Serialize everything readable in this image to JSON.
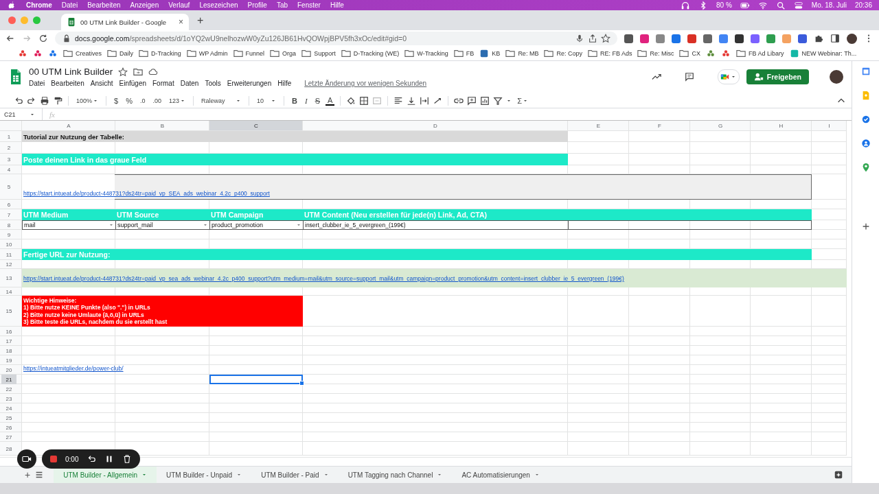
{
  "menubar": {
    "app": "Chrome",
    "menus": [
      "Datei",
      "Bearbeiten",
      "Anzeigen",
      "Verlauf",
      "Lesezeichen",
      "Profile",
      "Tab",
      "Fenster",
      "Hilfe"
    ],
    "battery": "80 %",
    "date": "Mo. 18. Juli",
    "time": "20:36"
  },
  "browser": {
    "tab_title": "00 UTM Link Builder - Google",
    "tab_close": "×",
    "new_tab": "+",
    "url_host": "docs.google.com",
    "url_path": "/spreadsheets/d/1oYQ2wU9nelhozwW0yZu126JB61HvQOWpjBPV5fh3xOc/edit#gid=0",
    "bookmarks": [
      {
        "kind": "icon"
      },
      {
        "kind": "icon"
      },
      {
        "kind": "icon"
      },
      {
        "kind": "folder",
        "label": "Creatives"
      },
      {
        "kind": "folder",
        "label": "Daily"
      },
      {
        "kind": "folder",
        "label": "D-Tracking"
      },
      {
        "kind": "folder",
        "label": "WP Admin"
      },
      {
        "kind": "folder",
        "label": "Funnel"
      },
      {
        "kind": "folder",
        "label": "Orga"
      },
      {
        "kind": "folder",
        "label": "Support"
      },
      {
        "kind": "folder",
        "label": "D-Tracking (WE)"
      },
      {
        "kind": "folder",
        "label": "W-Tracking"
      },
      {
        "kind": "folder",
        "label": "FB"
      },
      {
        "kind": "site",
        "label": "KB"
      },
      {
        "kind": "folder",
        "label": "Re: MB"
      },
      {
        "kind": "folder",
        "label": "Re: Copy"
      },
      {
        "kind": "folder",
        "label": "RE: FB Ads"
      },
      {
        "kind": "folder",
        "label": "Re: Misc"
      },
      {
        "kind": "folder",
        "label": "CX"
      },
      {
        "kind": "icon"
      },
      {
        "kind": "icon"
      },
      {
        "kind": "folder",
        "label": "FB Ad Libary"
      },
      {
        "kind": "site",
        "label": "NEW Webinar: Th..."
      }
    ]
  },
  "sheets": {
    "doc_title": "00 UTM Link Builder",
    "menus": [
      "Datei",
      "Bearbeiten",
      "Ansicht",
      "Einfügen",
      "Format",
      "Daten",
      "Tools",
      "Erweiterungen",
      "Hilfe"
    ],
    "last_edit": "Letzte Änderung vor wenigen Sekunden",
    "share": "Freigeben"
  },
  "toolbar": {
    "zoom": "100%",
    "currency": "$",
    "percent": "%",
    "decrease_decimals": ".0",
    "increase_decimals": ".00",
    "more_formats": "123",
    "font_picker": "Raleway",
    "size_picker": "10",
    "bold": "B",
    "italic": "I",
    "strikethrough": "S",
    "text_color": "A",
    "functions": "Σ"
  },
  "formula_bar": {
    "name_box": "C21",
    "formula_label": "fx"
  },
  "columns": [
    {
      "label": "A",
      "selected": false
    },
    {
      "label": "B",
      "selected": false
    },
    {
      "label": "C",
      "selected": true
    },
    {
      "label": "D",
      "selected": false
    },
    {
      "label": "E",
      "selected": false
    },
    {
      "label": "F",
      "selected": false
    },
    {
      "label": "G",
      "selected": false
    },
    {
      "label": "H",
      "selected": false
    },
    {
      "label": "I",
      "selected": false
    }
  ],
  "rows": [
    {
      "number": "1",
      "selected": false,
      "cells": [
        {
          "kind": "title",
          "text": "Tutorial zur Nutzung der Tabelle:"
        }
      ]
    },
    {
      "number": "2",
      "selected": false
    },
    {
      "number": "3",
      "selected": false,
      "cells": [
        {
          "kind": "banner",
          "text": "Poste deinen Link in das graue Feld"
        }
      ]
    },
    {
      "number": "4",
      "selected": false
    },
    {
      "number": "5",
      "selected": false,
      "cells": [
        {
          "kind": "input"
        },
        {
          "kind": "link",
          "text": "https://start.intueat.de/product-448731?ds24tr=paid_vp_SEA_ads_webinar_4.2c_p400_support"
        }
      ]
    },
    {
      "number": "6",
      "selected": false
    },
    {
      "number": "7",
      "selected": false,
      "cells": [
        {
          "kind": "band"
        },
        {
          "kind": "header",
          "text": "UTM Medium"
        },
        {
          "kind": "header",
          "text": "UTM Source"
        },
        {
          "kind": "header",
          "text": "UTM Campaign"
        },
        {
          "kind": "header",
          "text": "UTM Content (Neu erstellen für jede(n) Link, Ad, CTA)"
        }
      ]
    },
    {
      "number": "8",
      "selected": false,
      "cells": [
        {
          "kind": "dropdown",
          "text": "mail"
        },
        {
          "kind": "dropdown",
          "text": "support_mail"
        },
        {
          "kind": "dropdown",
          "text": "product_promotion"
        },
        {
          "kind": "value",
          "text": "insert_clubber_ie_5_evergreen_(199€)"
        },
        {
          "kind": "box"
        }
      ]
    },
    {
      "number": "9",
      "selected": false
    },
    {
      "number": "10",
      "selected": false
    },
    {
      "number": "11",
      "selected": false,
      "cells": [
        {
          "kind": "banner",
          "text": "Fertige URL zur Nutzung:"
        }
      ]
    },
    {
      "number": "12",
      "selected": false
    },
    {
      "number": "13",
      "selected": false,
      "cells": [
        {
          "kind": "output",
          "text": "https://start.intueat.de/product-448731?ds24tr=paid_vp_sea_ads_webinar_4.2c_p400_support?utm_medium=mail&utm_source=support_mail&utm_campaign=product_promotion&utm_content=insert_clubber_ie_5_evergreen_(199€)"
        }
      ]
    },
    {
      "number": "14",
      "selected": false
    },
    {
      "number": "15",
      "selected": false,
      "cells": [
        {
          "kind": "warning",
          "lines": [
            "Wichtige Hinweise:",
            "1) Bitte nutze KEINE Punkte (also \".\") in URLs",
            "2) Bitte nutze keine Umlaute (ä,ö,ü) in URLs",
            "3) Bitte teste die URLs, nachdem du sie erstellt hast"
          ]
        }
      ]
    },
    {
      "number": "16",
      "selected": false
    },
    {
      "number": "17",
      "selected": false
    },
    {
      "number": "18",
      "selected": false
    },
    {
      "number": "19",
      "selected": false
    },
    {
      "number": "20",
      "selected": false,
      "cells": [
        {
          "kind": "link",
          "text": "https://intueatmitglieder.de/power-club/"
        }
      ]
    },
    {
      "number": "21",
      "selected": true,
      "cells": [
        {
          "kind": "selection"
        }
      ]
    },
    {
      "number": "22",
      "selected": false
    },
    {
      "number": "23",
      "selected": false
    },
    {
      "number": "24",
      "selected": false
    },
    {
      "number": "25",
      "selected": false
    },
    {
      "number": "26",
      "selected": false
    },
    {
      "number": "27",
      "selected": false
    },
    {
      "number": "28",
      "selected": false
    }
  ],
  "sheet_tabs": [
    {
      "label": "UTM Builder - Allgemein",
      "selected": true
    },
    {
      "label": "UTM Builder - Unpaid",
      "selected": false
    },
    {
      "label": "UTM Builder - Paid",
      "selected": false
    },
    {
      "label": "UTM Tagging nach Channel",
      "selected": false
    },
    {
      "label": "AC Automatisierungen",
      "selected": false
    }
  ],
  "add_sheet": "+",
  "recorder": {
    "time": "0:00"
  }
}
